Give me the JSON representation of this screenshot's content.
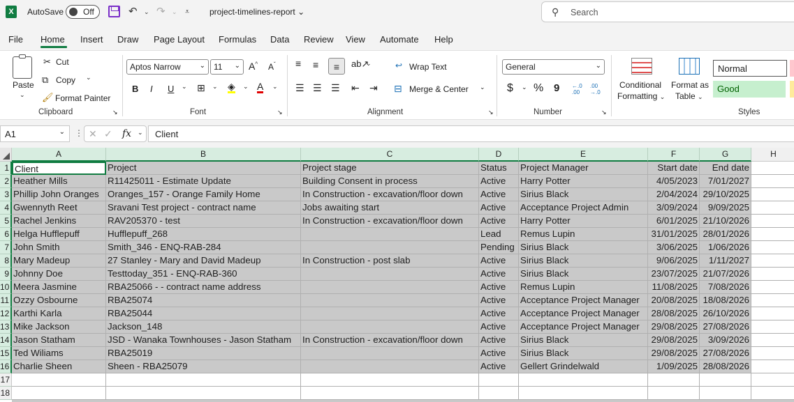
{
  "titlebar": {
    "autosave_label": "AutoSave",
    "autosave_state": "Off",
    "document_title": "project-timelines-report",
    "search_placeholder": "Search"
  },
  "menu": {
    "tabs": [
      "File",
      "Home",
      "Insert",
      "Draw",
      "Page Layout",
      "Formulas",
      "Data",
      "Review",
      "View",
      "Automate",
      "Help"
    ],
    "active": "Home"
  },
  "ribbon": {
    "clipboard": {
      "label": "Clipboard",
      "paste": "Paste",
      "cut": "Cut",
      "copy": "Copy",
      "format_painter": "Format Painter"
    },
    "font": {
      "label": "Font",
      "font_name": "Aptos Narrow",
      "font_size": "11",
      "bold": "B",
      "italic": "I",
      "underline": "U"
    },
    "alignment": {
      "label": "Alignment",
      "wrap_text": "Wrap Text",
      "merge_center": "Merge & Center"
    },
    "number": {
      "label": "Number",
      "format": "General",
      "currency": "$",
      "percent": "%",
      "comma": "9",
      "increase_decimal": "←.0\n.00",
      "decrease_decimal": ".00\n→.0"
    },
    "styles": {
      "label": "Styles",
      "conditional_formatting_1": "Conditional",
      "conditional_formatting_2": "Formatting",
      "format_as_table_1": "Format as",
      "format_as_table_2": "Table",
      "normal": "Normal",
      "good": "Good"
    }
  },
  "formula_bar": {
    "name_box": "A1",
    "fx": "fx",
    "content": "Client"
  },
  "sheet": {
    "columns": [
      "A",
      "B",
      "C",
      "D",
      "E",
      "F",
      "G",
      "H"
    ],
    "row_numbers": [
      "1",
      "2",
      "3",
      "4",
      "5",
      "6",
      "7",
      "8",
      "9",
      "10",
      "11",
      "12",
      "13",
      "14",
      "15",
      "16",
      "17",
      "18"
    ],
    "rows": [
      [
        "Client",
        "Project",
        "Project stage",
        "Status",
        "Project Manager",
        "Start date",
        "End date"
      ],
      [
        "Heather Mills",
        "R11425011 - Estimate Update",
        "Building Consent in process",
        "Active",
        "Harry Potter",
        "4/05/2023",
        "7/01/2027"
      ],
      [
        "Phillip John Oranges",
        "Oranges_157 - Orange Family Home",
        "In Construction - excavation/floor down",
        "Active",
        "Sirius Black",
        "2/04/2024",
        "29/10/2025"
      ],
      [
        "Gwennyth Reet",
        "Sravani Test project - contract name",
        "Jobs awaiting start",
        "Active",
        "Acceptance Project Admin",
        "3/09/2024",
        "9/09/2025"
      ],
      [
        "Rachel Jenkins",
        "RAV205370 - test",
        "In Construction - excavation/floor down",
        "Active",
        "Harry Potter",
        "6/01/2025",
        "21/10/2026"
      ],
      [
        "Helga  Hufflepuff",
        "Hufflepuff_268",
        "",
        "Lead",
        "Remus Lupin",
        "31/01/2025",
        "28/01/2026"
      ],
      [
        "John Smith",
        "Smith_346 - ENQ-RAB-284",
        "",
        "Pending",
        "Sirius Black",
        "3/06/2025",
        "1/06/2026"
      ],
      [
        "Mary Madeup",
        "27 Stanley - Mary and David Madeup",
        "In Construction - post slab",
        "Active",
        "Sirius Black",
        "9/06/2025",
        "1/11/2027"
      ],
      [
        "Johnny Doe",
        "Testtoday_351 - ENQ-RAB-360",
        "",
        "Active",
        "Sirius Black",
        "23/07/2025",
        "21/07/2026"
      ],
      [
        "Meera Jasmine",
        "RBA25066 - - contract name  address",
        "",
        "Active",
        "Remus Lupin",
        "11/08/2025",
        "7/08/2026"
      ],
      [
        "Ozzy Osbourne",
        "RBA25074",
        "",
        "Active",
        "Acceptance Project Manager",
        "20/08/2025",
        "18/08/2026"
      ],
      [
        "Karthi Karla",
        "RBA25044",
        "",
        "Active",
        "Acceptance Project Manager",
        "28/08/2025",
        "26/10/2026"
      ],
      [
        "Mike Jackson",
        "Jackson_148",
        "",
        "Active",
        "Acceptance Project Manager",
        "29/08/2025",
        "27/08/2026"
      ],
      [
        "Jason Statham",
        "JSD - Wanaka Townhouses - Jason Statham",
        "In Construction - excavation/floor down",
        "Active",
        "Sirius Black",
        "29/08/2025",
        "3/09/2026"
      ],
      [
        "Ted Wiliams",
        "RBA25019",
        "",
        "Active",
        "Sirius Black",
        "29/08/2025",
        "27/08/2026"
      ],
      [
        "Charlie Sheen",
        "Sheen - RBA25079",
        "",
        "Active",
        "Gellert Grindelwald",
        "1/09/2025",
        "28/08/2026"
      ],
      [
        "",
        "",
        "",
        "",
        "",
        "",
        ""
      ],
      [
        "",
        "",
        "",
        "",
        "",
        "",
        ""
      ]
    ]
  }
}
